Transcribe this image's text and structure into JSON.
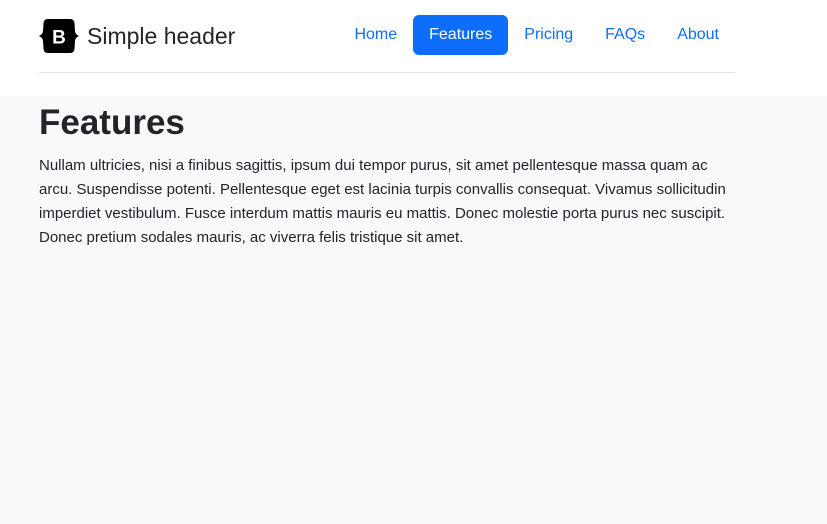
{
  "brand": {
    "logo_letter": "B",
    "title": "Simple header"
  },
  "nav": {
    "items": [
      {
        "label": "Home",
        "active": false
      },
      {
        "label": "Features",
        "active": true
      },
      {
        "label": "Pricing",
        "active": false
      },
      {
        "label": "FAQs",
        "active": false
      },
      {
        "label": "About",
        "active": false
      }
    ]
  },
  "main": {
    "heading": "Features",
    "paragraph": "Nullam ultricies, nisi a finibus sagittis, ipsum dui tempor purus, sit amet pellentesque massa quam ac arcu. Suspendisse potenti. Pellentesque eget est lacinia turpis convallis consequat. Vivamus sollicitudin imperdiet vestibulum. Fusce interdum mattis mauris eu mattis. Donec molestie porta purus nec suscipit. Donec pretium sodales mauris, ac viverra felis tristique sit amet."
  },
  "colors": {
    "accent": "#0d6efd",
    "page_background": "#f8f9fa",
    "header_background": "#ffffff",
    "text": "#212529",
    "divider": "#dee2e6"
  },
  "icons": {
    "brand_logo": "bootstrap-logo-icon"
  }
}
